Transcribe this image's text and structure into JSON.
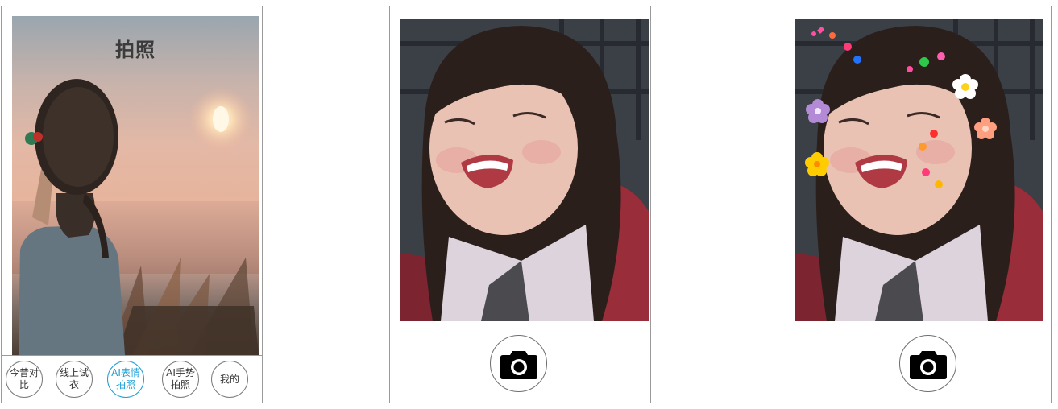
{
  "home": {
    "title": "拍照",
    "nav": [
      {
        "label": "今昔对比"
      },
      {
        "label": "线上试衣"
      },
      {
        "label": "AI表情拍照",
        "active": true
      },
      {
        "label": "AI手势拍照"
      },
      {
        "label": "我的"
      }
    ]
  },
  "camera_screens": [
    {
      "id": "camera-plain",
      "photo": "smiling-girl-photo",
      "shutter_icon": "camera-icon"
    },
    {
      "id": "camera-stickers",
      "photo": "smiling-girl-photo-with-flower-and-heart-stickers",
      "shutter_icon": "camera-icon"
    }
  ],
  "colors": {
    "accent": "#1a9fd6",
    "border": "#9a9a9a",
    "text": "#333333",
    "title": "#3b3b3b"
  }
}
